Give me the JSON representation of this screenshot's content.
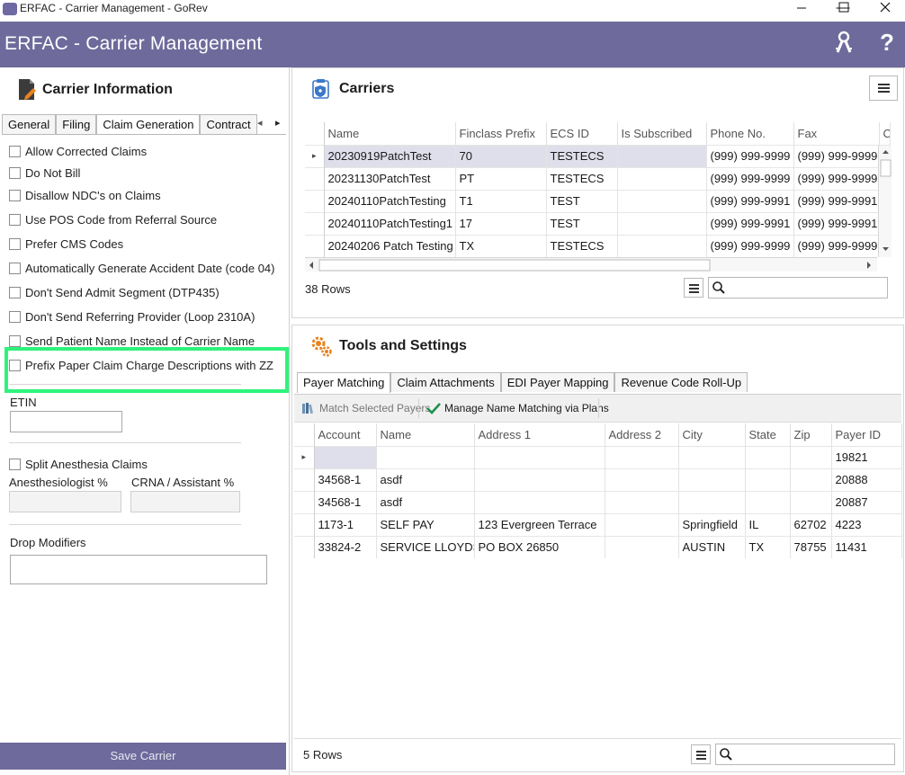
{
  "window": {
    "title": "ERFAC - Carrier Management - GoRev",
    "controls": {
      "minimize": "—",
      "maximize": "☐",
      "close": "✕"
    }
  },
  "header": {
    "title": "ERFAC - Carrier Management",
    "icons": [
      "keys-icon",
      "help-icon"
    ],
    "help_glyph": "?"
  },
  "colors": {
    "brand": "#6e6a9b",
    "highlight": "#2ef37a",
    "selected_row": "#dedfeb",
    "accent_orange": "#e8821e"
  },
  "left_panel": {
    "title": "Carrier Information",
    "tabs": [
      "General",
      "Filing",
      "Claim Generation",
      "Contract"
    ],
    "active_tab": "Claim Generation",
    "tab_nav": {
      "prev": "◂",
      "next": "▸"
    },
    "checkboxes": [
      {
        "label": "Allow Corrected Claims",
        "checked": false
      },
      {
        "label": "Do Not Bill",
        "checked": false
      },
      {
        "label": "Disallow NDC's on Claims",
        "checked": false
      },
      {
        "label": "Use POS Code from Referral Source",
        "checked": false
      },
      {
        "label": "Prefer CMS Codes",
        "checked": false
      },
      {
        "label": "Automatically Generate Accident Date (code 04)",
        "checked": false
      },
      {
        "label": "Don't Send Admit Segment (DTP435)",
        "checked": false
      },
      {
        "label": "Don't Send Referring Provider (Loop 2310A)",
        "checked": false
      },
      {
        "label": "Send Patient Name Instead of Carrier Name",
        "checked": false
      },
      {
        "label": "Prefix Paper Claim Charge Descriptions with ZZ",
        "checked": false
      }
    ],
    "etin": {
      "label": "ETIN",
      "value": ""
    },
    "split_anesthesia": {
      "label": "Split Anesthesia Claims",
      "checked": false
    },
    "anesthesiologist": {
      "label": "Anesthesiologist %",
      "value": ""
    },
    "crna": {
      "label": "CRNA / Assistant %",
      "value": ""
    },
    "drop_modifiers": {
      "label": "Drop Modifiers",
      "value": ""
    },
    "save_button": "Save Carrier"
  },
  "carriers": {
    "title": "Carriers",
    "columns": [
      "Name",
      "Finclass Prefix",
      "ECS ID",
      "Is Subscribed",
      "Phone No.",
      "Fax",
      "Ci"
    ],
    "rows": [
      [
        "20230919PatchTest",
        "70",
        "TESTECS",
        "",
        "(999) 999-9999",
        "(999) 999-9999",
        ""
      ],
      [
        "20231130PatchTest",
        "PT",
        "TESTECS",
        "",
        "(999) 999-9999",
        "(999) 999-9999",
        ""
      ],
      [
        "20240110PatchTesting",
        "T1",
        "TEST",
        "",
        "(999) 999-9991",
        "(999) 999-9991",
        ""
      ],
      [
        "20240110PatchTesting1",
        "17",
        "TEST",
        "",
        "(999) 999-9991",
        "(999) 999-9991",
        ""
      ],
      [
        "20240206 Patch Testing",
        "TX",
        "TESTECS",
        "",
        "(999) 999-9999",
        "(999) 999-9999",
        ""
      ]
    ],
    "row_count": "38 Rows",
    "search": {
      "value": "",
      "placeholder": ""
    }
  },
  "tools": {
    "title": "Tools and Settings",
    "tabs": [
      "Payer Matching",
      "Claim Attachments",
      "EDI Payer Mapping",
      "Revenue Code Roll-Up"
    ],
    "active_tab": "Payer Matching",
    "toolbar": {
      "match_selected": "Match Selected Payers",
      "manage_name_matching": "Manage Name Matching via Plans"
    },
    "columns": [
      "Account",
      "Name",
      "Address 1",
      "Address 2",
      "City",
      "State",
      "Zip",
      "Payer ID"
    ],
    "rows": [
      [
        "",
        "",
        "",
        "",
        "",
        "",
        "",
        "19821"
      ],
      [
        "34568-1",
        "asdf",
        "",
        "",
        "",
        "",
        "",
        "20888"
      ],
      [
        "34568-1",
        "asdf",
        "",
        "",
        "",
        "",
        "",
        "20887"
      ],
      [
        "1173-1",
        "SELF PAY",
        "123 Evergreen Terrace",
        "",
        "Springfield",
        "IL",
        "62702",
        "4223"
      ],
      [
        "33824-2",
        "SERVICE LLOYDS",
        "PO BOX 26850",
        "",
        "AUSTIN",
        "TX",
        "78755",
        "11431"
      ]
    ],
    "row_count": "5 Rows",
    "search": {
      "value": "",
      "placeholder": ""
    }
  }
}
